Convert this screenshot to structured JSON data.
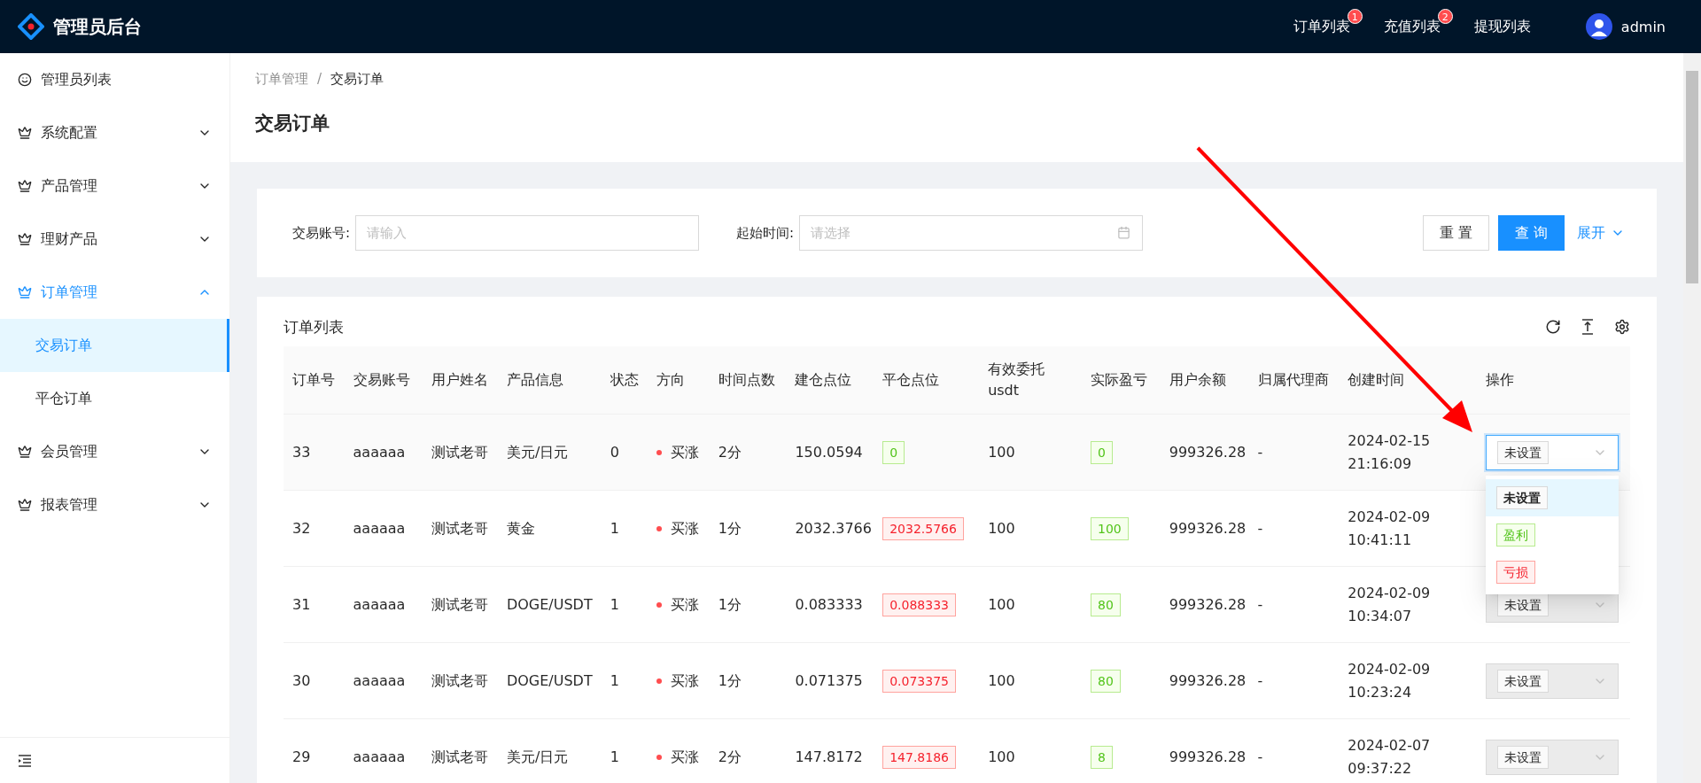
{
  "header": {
    "title": "管理员后台",
    "nav": [
      {
        "label": "订单列表",
        "badge": "1"
      },
      {
        "label": "充值列表",
        "badge": "2"
      },
      {
        "label": "提现列表"
      }
    ],
    "user": "admin"
  },
  "sidebar": {
    "items": [
      {
        "label": "管理员列表",
        "selected": false
      },
      {
        "label": "系统配置",
        "expanded": false,
        "selected": false
      },
      {
        "label": "产品管理",
        "expanded": false,
        "selected": false
      },
      {
        "label": "理财产品",
        "expanded": false,
        "selected": false
      },
      {
        "label": "订单管理",
        "expanded": true,
        "selected": true,
        "children": [
          {
            "label": "交易订单",
            "selected": true
          },
          {
            "label": "平仓订单",
            "selected": false
          }
        ]
      },
      {
        "label": "会员管理",
        "expanded": false,
        "selected": false
      },
      {
        "label": "报表管理",
        "expanded": false,
        "selected": false
      }
    ]
  },
  "breadcrumb": [
    "订单管理",
    "交易订单"
  ],
  "breadcrumb_separator": "/",
  "page_title": "交易订单",
  "search": {
    "fields": [
      {
        "label": "交易账号:",
        "placeholder": "请输入",
        "kind": "text"
      },
      {
        "label": "起始时间:",
        "placeholder": "请选择",
        "kind": "date"
      }
    ],
    "buttons": [
      {
        "label": "重 置",
        "kind": "default"
      },
      {
        "label": "查 询",
        "kind": "primary"
      },
      {
        "label": "展开",
        "kind": "link"
      }
    ]
  },
  "table": {
    "title": "订单列表",
    "columns": [
      "订单号",
      "交易账号",
      "用户姓名",
      "产品信息",
      "状态",
      "方向",
      "时间点数",
      "建仓点位",
      "平仓点位",
      "有效委托usdt",
      "实际盈亏",
      "用户余额",
      "归属代理商",
      "创建时间",
      "操作"
    ],
    "rows": [
      {
        "id": "33",
        "account": "aaaaaa",
        "user": "测试老哥",
        "product": "美元/日元",
        "status": "0",
        "direction": "买涨",
        "minutes": "2分",
        "open": "150.0594",
        "close": {
          "text": "0",
          "kind": "profit"
        },
        "amount": "100",
        "pnl": {
          "text": "0",
          "kind": "profit"
        },
        "balance": "999326.28",
        "agent": "-",
        "created": [
          "2024-02-15",
          "21:16:09"
        ],
        "action": {
          "value": "未设置",
          "open": true,
          "disabled": false
        }
      },
      {
        "id": "32",
        "account": "aaaaaa",
        "user": "测试老哥",
        "product": "黄金",
        "status": "1",
        "direction": "买涨",
        "minutes": "1分",
        "open": "2032.3766",
        "close": {
          "text": "2032.5766",
          "kind": "loss"
        },
        "amount": "100",
        "pnl": {
          "text": "100",
          "kind": "profit"
        },
        "balance": "999326.28",
        "agent": "-",
        "created": [
          "2024-02-09",
          "10:41:11"
        ]
      },
      {
        "id": "31",
        "account": "aaaaaa",
        "user": "测试老哥",
        "product": "DOGE/USDT",
        "status": "1",
        "direction": "买涨",
        "minutes": "1分",
        "open": "0.083333",
        "close": {
          "text": "0.088333",
          "kind": "loss"
        },
        "amount": "100",
        "pnl": {
          "text": "80",
          "kind": "profit"
        },
        "balance": "999326.28",
        "agent": "-",
        "created": [
          "2024-02-09",
          "10:34:07"
        ],
        "action": {
          "value": "未设置",
          "open": false,
          "disabled": true
        }
      },
      {
        "id": "30",
        "account": "aaaaaa",
        "user": "测试老哥",
        "product": "DOGE/USDT",
        "status": "1",
        "direction": "买涨",
        "minutes": "1分",
        "open": "0.071375",
        "close": {
          "text": "0.073375",
          "kind": "loss"
        },
        "amount": "100",
        "pnl": {
          "text": "80",
          "kind": "profit"
        },
        "balance": "999326.28",
        "agent": "-",
        "created": [
          "2024-02-09",
          "10:23:24"
        ],
        "action": {
          "value": "未设置",
          "open": false,
          "disabled": true
        }
      },
      {
        "id": "29",
        "account": "aaaaaa",
        "user": "测试老哥",
        "product": "美元/日元",
        "status": "1",
        "direction": "买涨",
        "minutes": "2分",
        "open": "147.8172",
        "close": {
          "text": "147.8186",
          "kind": "loss"
        },
        "amount": "100",
        "pnl": {
          "text": "8",
          "kind": "profit"
        },
        "balance": "999326.28",
        "agent": "-",
        "created": [
          "2024-02-07",
          "09:37:22"
        ],
        "action": {
          "value": "未设置",
          "open": false,
          "disabled": true
        }
      }
    ],
    "action_options": [
      {
        "label": "未设置",
        "kind": "neutral",
        "selected": true
      },
      {
        "label": "盈利",
        "kind": "profit",
        "selected": false
      },
      {
        "label": "亏损",
        "kind": "loss",
        "selected": false
      }
    ]
  },
  "annotations": [
    {
      "kind": "arrow"
    }
  ]
}
